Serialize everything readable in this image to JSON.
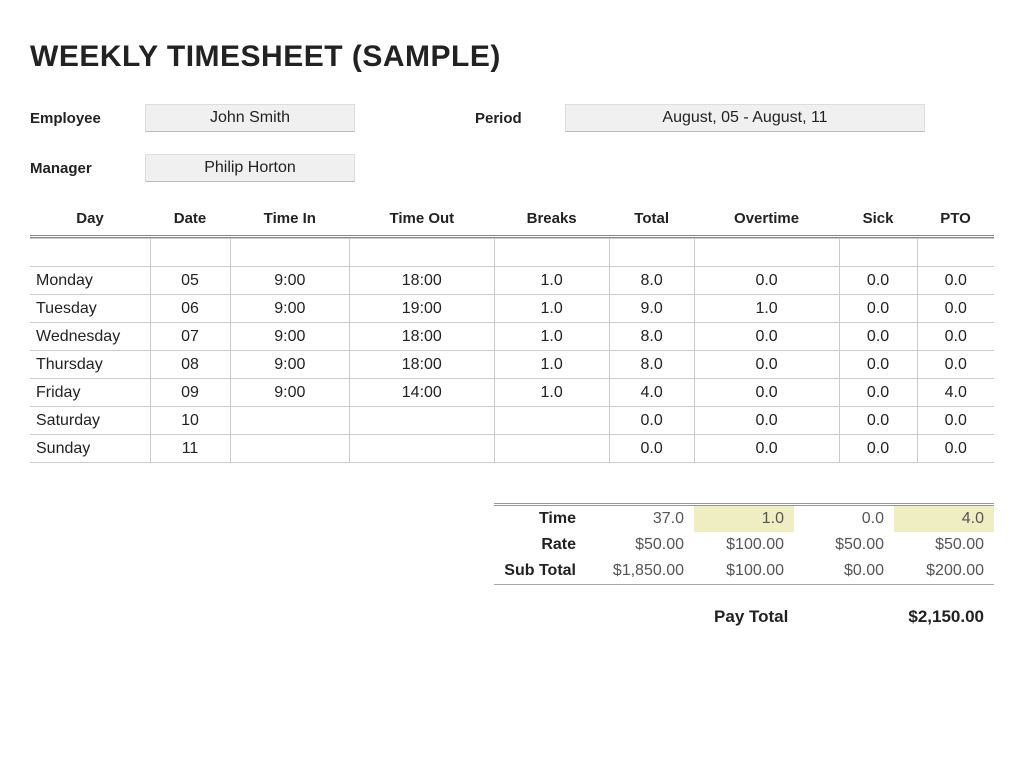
{
  "title": "WEEKLY TIMESHEET (SAMPLE)",
  "meta": {
    "employee_label": "Employee",
    "employee": "John Smith",
    "period_label": "Period",
    "period": "August, 05 - August, 11",
    "manager_label": "Manager",
    "manager": "Philip Horton"
  },
  "columns": {
    "day": "Day",
    "date": "Date",
    "time_in": "Time In",
    "time_out": "Time Out",
    "breaks": "Breaks",
    "total": "Total",
    "overtime": "Overtime",
    "sick": "Sick",
    "pto": "PTO"
  },
  "rows": [
    {
      "day": "Monday",
      "date": "05",
      "time_in": "9:00",
      "time_out": "18:00",
      "breaks": "1.0",
      "total": "8.0",
      "overtime": "0.0",
      "sick": "0.0",
      "pto": "0.0"
    },
    {
      "day": "Tuesday",
      "date": "06",
      "time_in": "9:00",
      "time_out": "19:00",
      "breaks": "1.0",
      "total": "9.0",
      "overtime": "1.0",
      "sick": "0.0",
      "pto": "0.0"
    },
    {
      "day": "Wednesday",
      "date": "07",
      "time_in": "9:00",
      "time_out": "18:00",
      "breaks": "1.0",
      "total": "8.0",
      "overtime": "0.0",
      "sick": "0.0",
      "pto": "0.0"
    },
    {
      "day": "Thursday",
      "date": "08",
      "time_in": "9:00",
      "time_out": "18:00",
      "breaks": "1.0",
      "total": "8.0",
      "overtime": "0.0",
      "sick": "0.0",
      "pto": "0.0"
    },
    {
      "day": "Friday",
      "date": "09",
      "time_in": "9:00",
      "time_out": "14:00",
      "breaks": "1.0",
      "total": "4.0",
      "overtime": "0.0",
      "sick": "0.0",
      "pto": "4.0"
    },
    {
      "day": "Saturday",
      "date": "10",
      "time_in": "",
      "time_out": "",
      "breaks": "",
      "total": "0.0",
      "overtime": "0.0",
      "sick": "0.0",
      "pto": "0.0"
    },
    {
      "day": "Sunday",
      "date": "11",
      "time_in": "",
      "time_out": "",
      "breaks": "",
      "total": "0.0",
      "overtime": "0.0",
      "sick": "0.0",
      "pto": "0.0"
    }
  ],
  "summary": {
    "labels": {
      "time": "Time",
      "rate": "Rate",
      "subtotal": "Sub Total",
      "paytotal": "Pay Total"
    },
    "time": {
      "total": "37.0",
      "overtime": "1.0",
      "sick": "0.0",
      "pto": "4.0"
    },
    "rate": {
      "total": "$50.00",
      "overtime": "$100.00",
      "sick": "$50.00",
      "pto": "$50.00"
    },
    "subtotal": {
      "total": "$1,850.00",
      "overtime": "$100.00",
      "sick": "$0.00",
      "pto": "$200.00"
    },
    "paytotal": "$2,150.00"
  }
}
